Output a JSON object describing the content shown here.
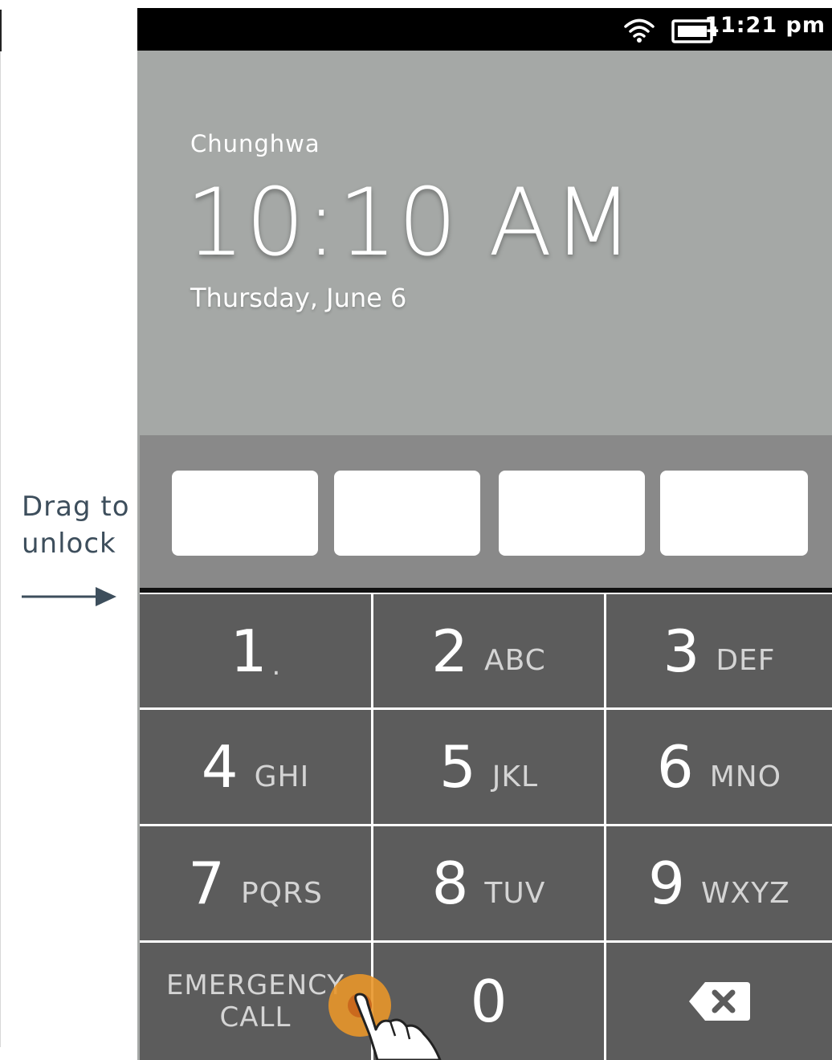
{
  "annotation": {
    "drag_text": "Drag to\nunlock",
    "arrow_icon": "right-arrow-icon"
  },
  "statusbar": {
    "time": "11:21 pm",
    "wifi_icon": "wifi-icon",
    "battery_icon": "battery-icon"
  },
  "lockscreen": {
    "carrier": "Chunghwa",
    "time": "10:10 AM",
    "date": "Thursday, June 6"
  },
  "passcode": {
    "digits_count_shown": 4
  },
  "keypad": {
    "keys": [
      {
        "num": "1",
        "letters": "."
      },
      {
        "num": "2",
        "letters": "ABC"
      },
      {
        "num": "3",
        "letters": "DEF"
      },
      {
        "num": "4",
        "letters": "GHI"
      },
      {
        "num": "5",
        "letters": "JKL"
      },
      {
        "num": "6",
        "letters": "MNO"
      },
      {
        "num": "7",
        "letters": "PQRS"
      },
      {
        "num": "8",
        "letters": "TUV"
      },
      {
        "num": "9",
        "letters": "WXYZ"
      },
      {
        "num": "0",
        "letters": ""
      }
    ],
    "emergency_label": "EMERGENCY\nCALL",
    "delete_icon": "backspace-icon"
  },
  "colors": {
    "screen_bg": "#a5a8a6",
    "pin_area_bg": "#898989",
    "key_bg": "#5c5c5c",
    "touch_accent": "#e8962a"
  }
}
